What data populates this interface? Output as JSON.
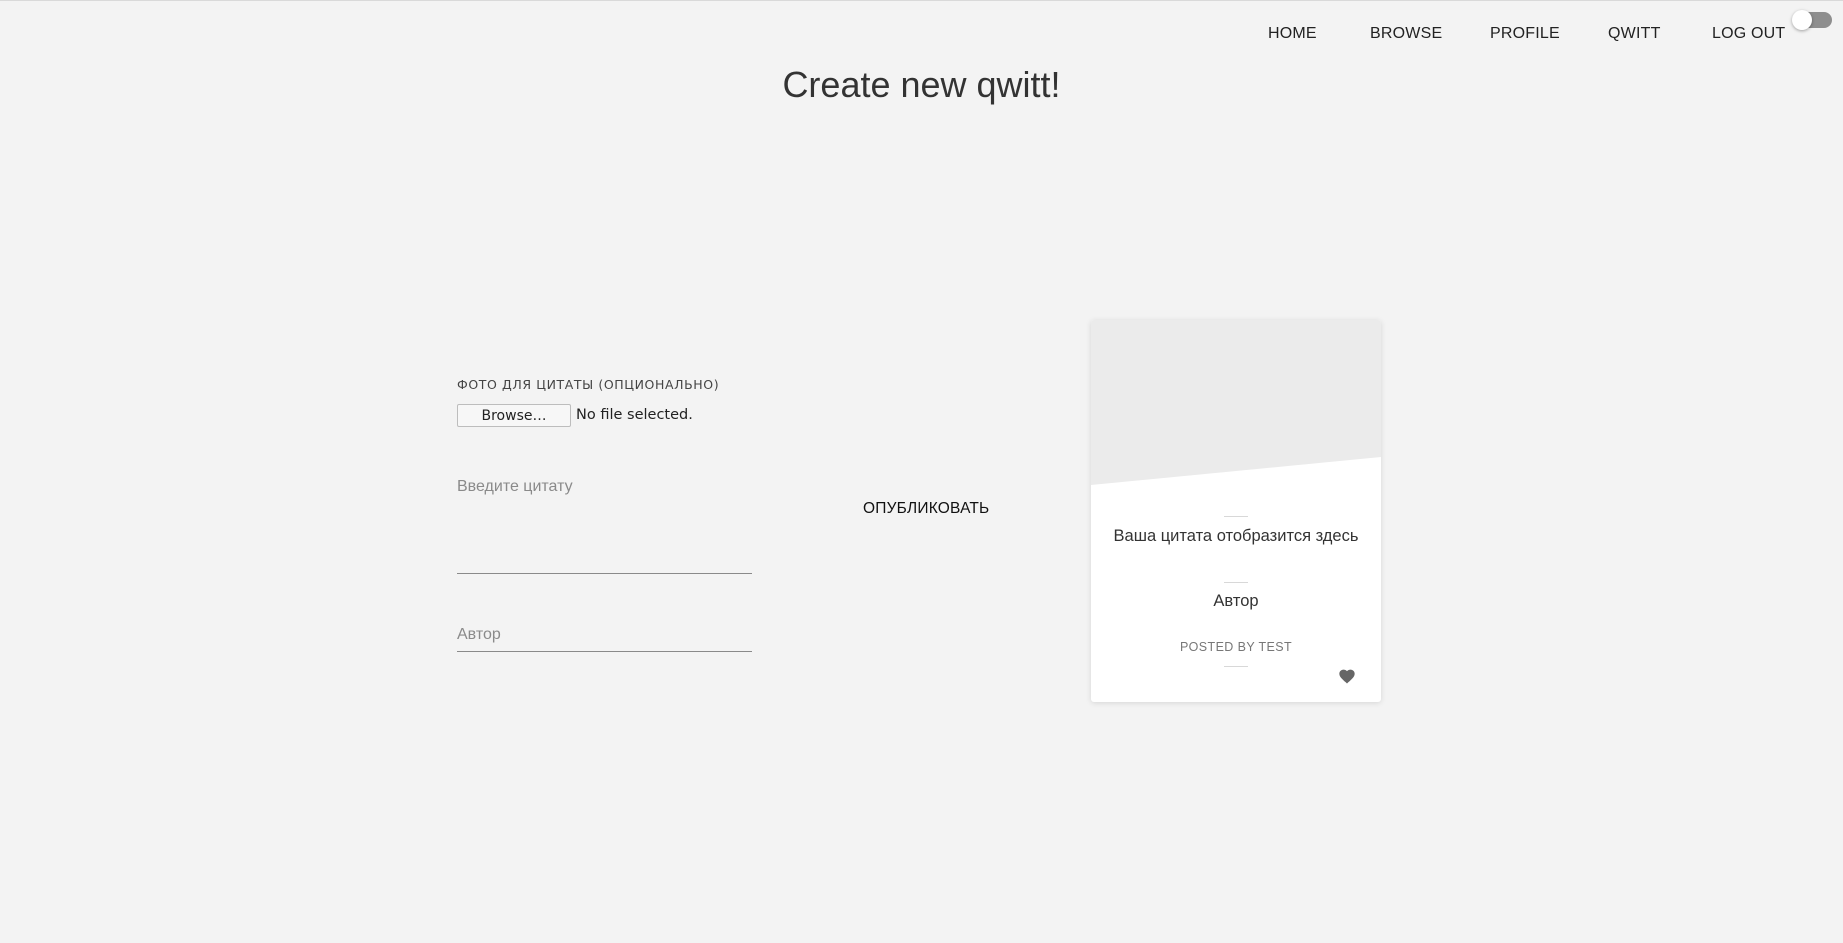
{
  "nav": {
    "items": [
      {
        "label": "HOME"
      },
      {
        "label": "BROWSE"
      },
      {
        "label": "PROFILE"
      },
      {
        "label": "QWITT"
      },
      {
        "label": "LOG OUT"
      }
    ],
    "theme_toggle_on": false
  },
  "page": {
    "title": "Create new qwitt!"
  },
  "form": {
    "photo_label": "ФОТО ДЛЯ ЦИТАТЫ (ОПЦИОНАЛЬНО)",
    "browse_label": "Browse…",
    "file_status": "No file selected.",
    "quote_placeholder": "Введите цитату",
    "quote_value": "",
    "author_placeholder": "Автор",
    "author_value": "",
    "publish_label": "ОПУБЛИКОВАТЬ"
  },
  "preview": {
    "quote": "Ваша цитата отобразится здесь",
    "author": "Автор",
    "posted_by": "POSTED BY TEST",
    "heart_icon": "heart-icon"
  },
  "colors": {
    "background": "#f3f3f3",
    "card": "#ffffff",
    "image_placeholder": "#ebebeb",
    "toggle_track": "#8e8e8e"
  }
}
